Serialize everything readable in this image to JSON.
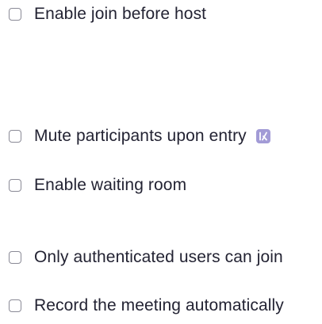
{
  "options": [
    {
      "label": "Enable join before host",
      "checked": false
    },
    {
      "label": "Mute participants upon entry",
      "checked": false,
      "icon": "locked-setting-icon",
      "icon_color": "#a29bd6"
    },
    {
      "label": "Enable waiting room",
      "checked": false
    },
    {
      "label": "Only authenticated users can join",
      "checked": false
    },
    {
      "label": "Record the meeting automatically",
      "checked": false
    }
  ],
  "colors": {
    "text": "#232333",
    "checkbox_border": "#8a8a96",
    "lock_icon": "#a29bd6"
  }
}
